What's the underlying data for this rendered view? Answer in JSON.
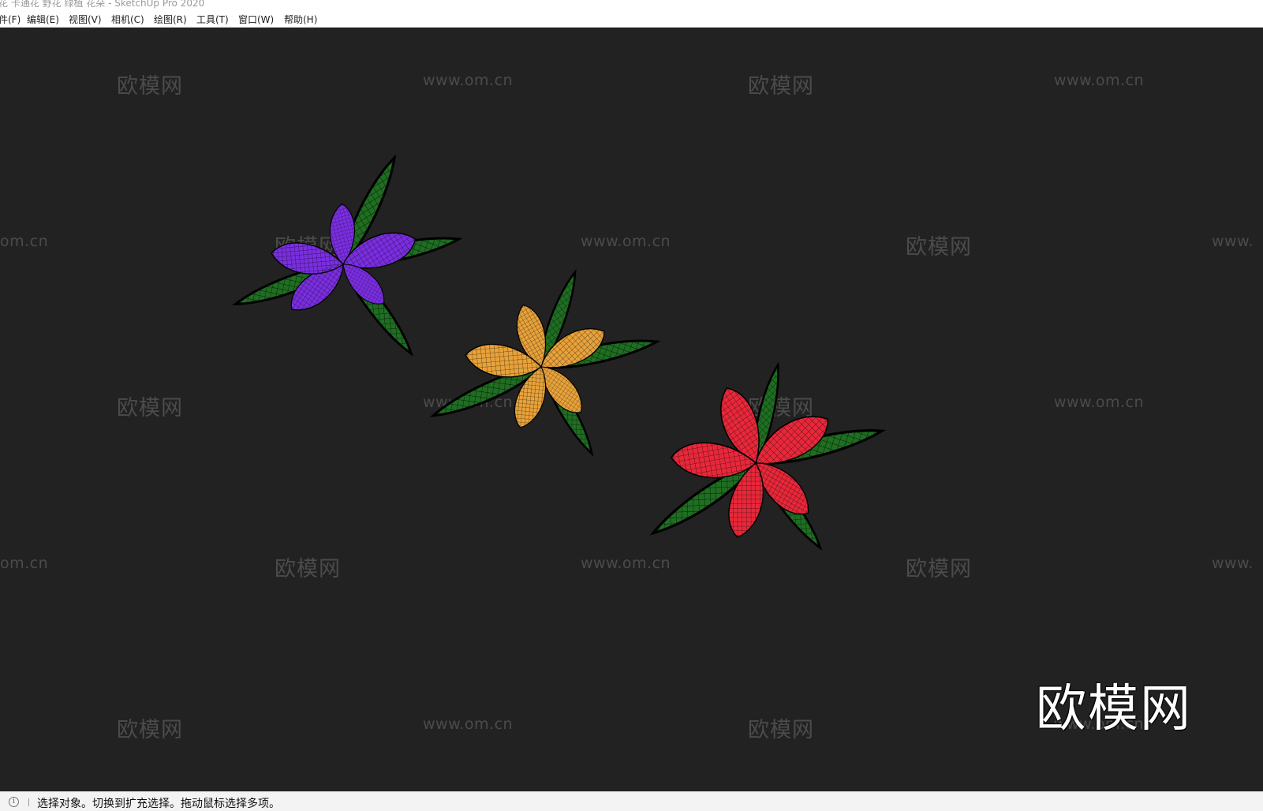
{
  "window": {
    "title": "花 卡通花 野花 绿植 花朵 - SketchUp Pro 2020"
  },
  "menu": {
    "items": [
      {
        "label": "件(F)"
      },
      {
        "label": "编辑(E)"
      },
      {
        "label": "视图(V)"
      },
      {
        "label": "相机(C)"
      },
      {
        "label": "绘图(R)"
      },
      {
        "label": "工具(T)"
      },
      {
        "label": "窗口(W)"
      },
      {
        "label": "帮助(H)"
      }
    ]
  },
  "watermarks": {
    "url_text": "www.om.cn",
    "url_partial_right": "www.",
    "url_partial_left": "om.cn",
    "brand_text": "欧模网"
  },
  "viewport": {
    "background_color": "#222222",
    "flowers": [
      {
        "name": "purple",
        "petal_color": "#7a2ee0"
      },
      {
        "name": "orange",
        "petal_color": "#e8a23a"
      },
      {
        "name": "red",
        "petal_color": "#e8283a"
      }
    ],
    "leaf_color": "#1f6e22"
  },
  "status": {
    "icon": "info-icon",
    "message": "选择对象。切换到扩充选择。拖动鼠标选择多项。"
  }
}
